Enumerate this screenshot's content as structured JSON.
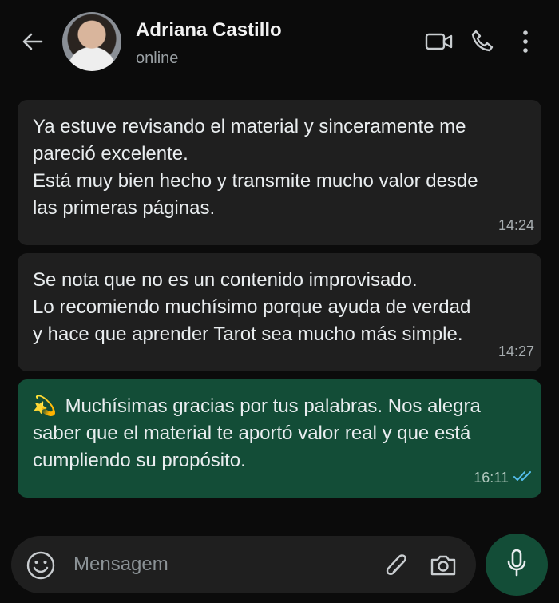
{
  "header": {
    "contact_name": "Adriana Castillo",
    "status": "online",
    "icons": [
      "back-arrow-icon",
      "video-call-icon",
      "phone-icon",
      "more-options-icon"
    ]
  },
  "messages": [
    {
      "direction": "incoming",
      "text": "Ya estuve revisando el material y sinceramente me\npareció excelente.\nEstá muy bien hecho y transmite mucho valor desde\nlas primeras páginas.",
      "time": "14:24"
    },
    {
      "direction": "incoming",
      "text": "Se nota que no es un contenido improvisado.\nLo recomiendo muchísimo porque ayuda de verdad\ny hace que aprender Tarot sea mucho más simple.",
      "time": "14:27"
    },
    {
      "direction": "outgoing",
      "emoji": "💫",
      "text": "Muchísimas gracias por tus palabras. Nos alegra\nsaber que el material te aportó valor real y que está\ncumpliendo su propósito.",
      "time": "16:11",
      "read_receipt": "double-check-icon"
    }
  ],
  "composer": {
    "placeholder": "Mensagem",
    "icons": [
      "emoji-icon",
      "attach-icon",
      "camera-icon",
      "microphone-icon"
    ]
  },
  "colors": {
    "background": "#0b0b0b",
    "incoming_bubble": "#1f1f1f",
    "outgoing_bubble": "#134d37",
    "read_receipt": "#53bdeb"
  }
}
